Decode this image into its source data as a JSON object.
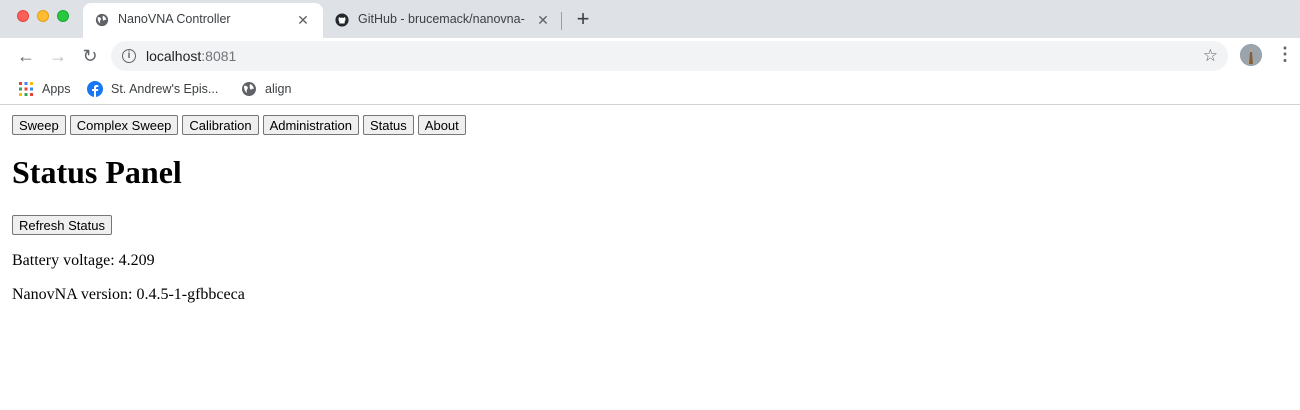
{
  "browser": {
    "tabs": [
      {
        "title": "NanoVNA Controller",
        "active": true,
        "icon": "globe-icon"
      },
      {
        "title": "GitHub - brucemack/nanovna-",
        "active": false,
        "icon": "github-icon"
      }
    ],
    "address": {
      "host": "localhost",
      "port": ":8081"
    },
    "bookmarks": [
      {
        "label": "Apps",
        "icon": "apps-grid-icon"
      },
      {
        "label": "St. Andrew's Epis...",
        "icon": "facebook-icon"
      },
      {
        "label": "align",
        "icon": "globe-icon"
      }
    ],
    "colors": {
      "tabstrip": "#dee1e6",
      "omnibox": "#f1f3f4"
    }
  },
  "page": {
    "nav_buttons": [
      "Sweep",
      "Complex Sweep",
      "Calibration",
      "Administration",
      "Status",
      "About"
    ],
    "title": "Status Panel",
    "refresh_label": "Refresh Status",
    "battery_label": "Battery voltage:",
    "battery_value": "4.209",
    "version_label": "NanovNA version:",
    "version_value": "0.4.5-1-gfbbceca"
  }
}
